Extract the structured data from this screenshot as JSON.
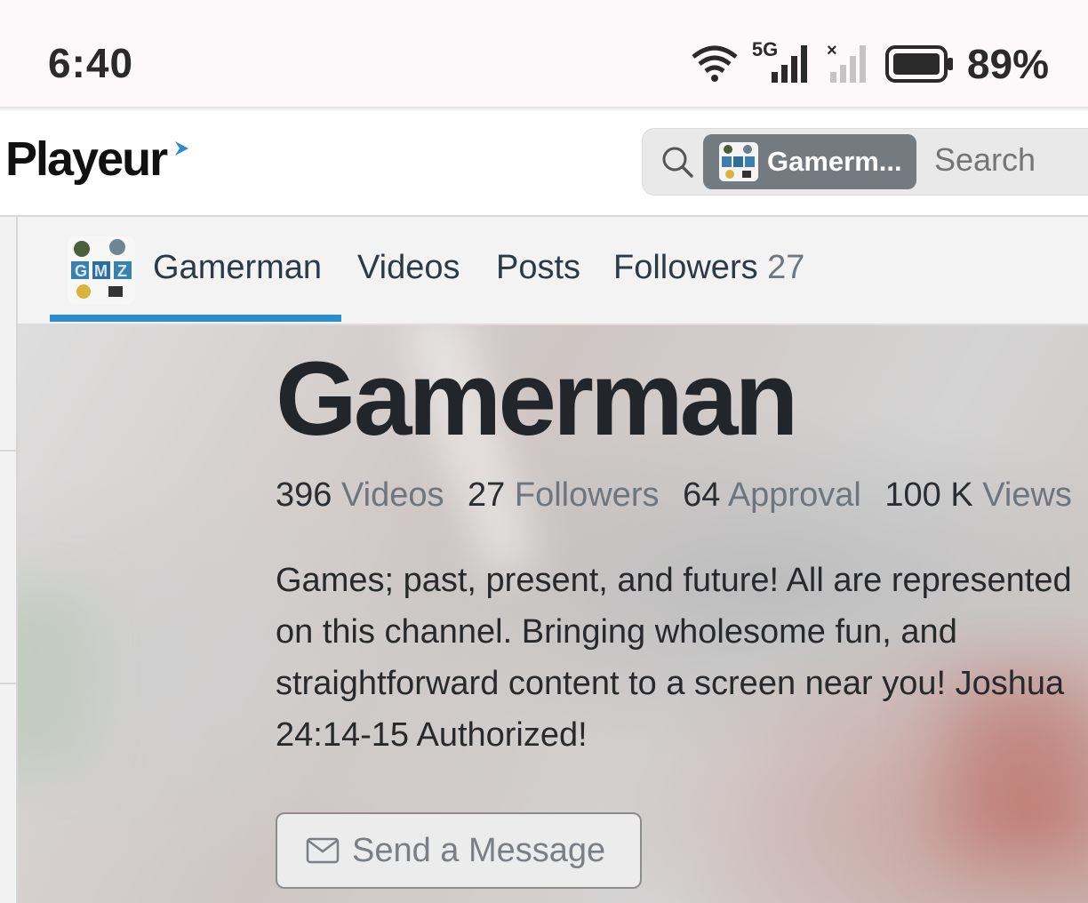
{
  "status_bar": {
    "time": "6:40",
    "network_label": "5G",
    "battery_percent": "89%",
    "icons": [
      "wifi-icon",
      "signal-5g-icon",
      "signal-no-service-icon",
      "battery-icon"
    ]
  },
  "header": {
    "logo": {
      "text_main": "Playe",
      "text_accent": "ur",
      "arrow_color": "#2d8ccf"
    },
    "search": {
      "chip_label": "Gamerm...",
      "placeholder": "Search"
    }
  },
  "tabs": [
    {
      "label": "Gamerman",
      "active": true
    },
    {
      "label": "Videos"
    },
    {
      "label": "Posts"
    },
    {
      "label": "Followers",
      "count": "27"
    }
  ],
  "channel": {
    "title": "Gamerman",
    "stats": [
      {
        "value": "396",
        "label": "Videos"
      },
      {
        "value": "27",
        "label": "Followers"
      },
      {
        "value": "64",
        "label": "Approval"
      },
      {
        "value": "100 K",
        "label": "Views"
      }
    ],
    "description_lines": [
      "Games; past, present, and future! All are represented",
      "on this channel. Bringing wholesome fun, and",
      "straightforward content to a screen near you! Joshua",
      "24:14-15 Authorized!"
    ],
    "message_button": "Send a Message"
  },
  "colors": {
    "accent": "#2d8ccf",
    "chip_bg": "#737a80",
    "tab_text": "#2c3a47"
  }
}
